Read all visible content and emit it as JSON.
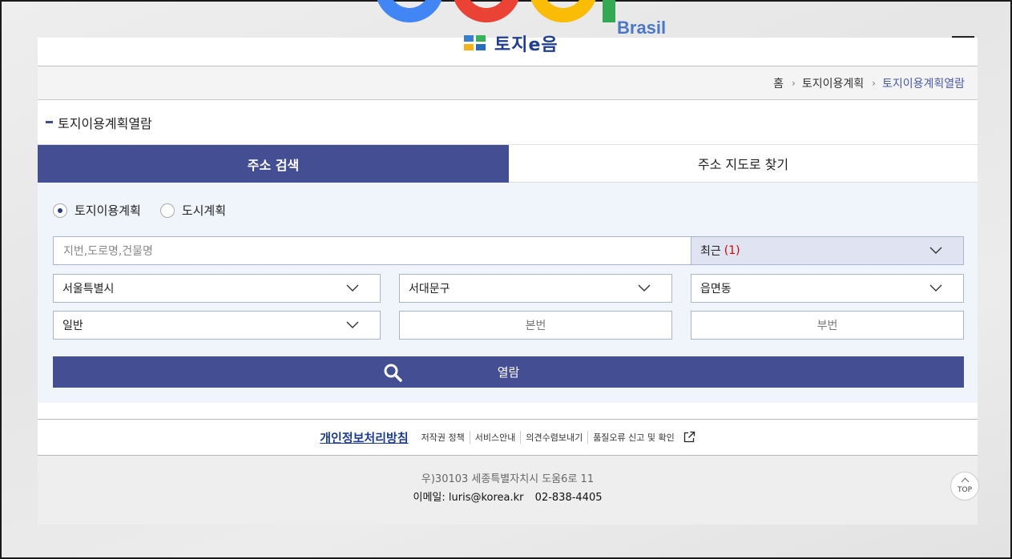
{
  "background": {
    "logo_text": "Brasil"
  },
  "header": {
    "logo_text": "토지e음"
  },
  "breadcrumb": {
    "items": [
      "홈",
      "토지이용계획",
      "토지이용계획열람"
    ]
  },
  "section": {
    "title": "토지이용계획열람"
  },
  "tabs": [
    {
      "label": "주소 검색",
      "active": true
    },
    {
      "label": "주소 지도로 찾기",
      "active": false
    }
  ],
  "search": {
    "radio_options": [
      {
        "label": "토지이용계획",
        "checked": true
      },
      {
        "label": "도시계획",
        "checked": false
      }
    ],
    "address_placeholder": "지번,도로명,건물명",
    "recent_label": "최근",
    "recent_count": "(1)",
    "city": "서울특별시",
    "district": "서대문구",
    "town": "읍면동",
    "land_type": "일반",
    "main_number_placeholder": "본번",
    "sub_number_placeholder": "부번",
    "view_button": "열람"
  },
  "footer": {
    "privacy": "개인정보처리방침",
    "links": [
      "저작권 정책",
      "서비스안내",
      "의견수렴보내기",
      "품질오류 신고 및 확인"
    ],
    "address": "우)30103 세종특별자치시 도움6로 11",
    "email": "이메일: luris@korea.kr",
    "phone": "02-838-4405",
    "top_label": "TOP"
  },
  "colors": {
    "primary": "#444e93",
    "panel_bg": "#f0f5fc",
    "accent_link": "#4a5aa8",
    "red_count": "#d40000"
  }
}
